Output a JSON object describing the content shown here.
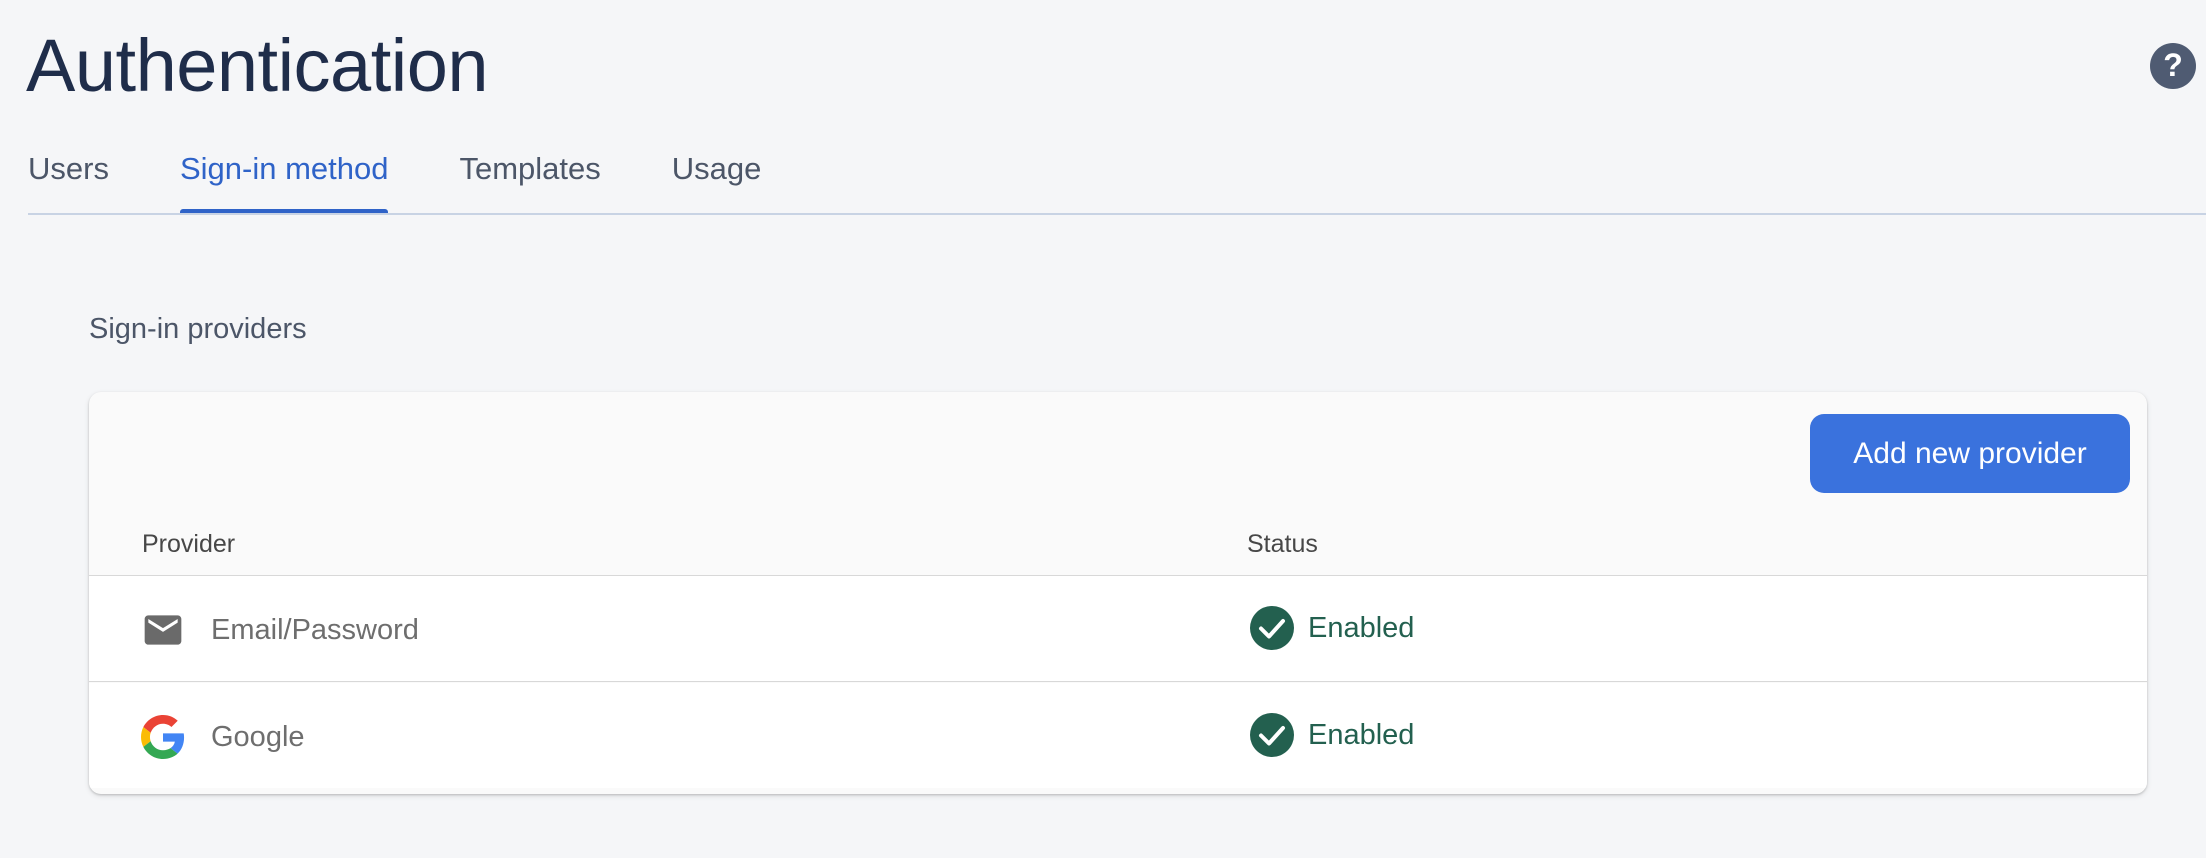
{
  "header": {
    "title": "Authentication",
    "help_icon": "help-circle-icon"
  },
  "tabs": [
    {
      "label": "Users",
      "active": false
    },
    {
      "label": "Sign-in method",
      "active": true
    },
    {
      "label": "Templates",
      "active": false
    },
    {
      "label": "Usage",
      "active": false
    }
  ],
  "section": {
    "title": "Sign-in providers"
  },
  "card": {
    "add_button_label": "Add new provider",
    "columns": {
      "provider": "Provider",
      "status": "Status"
    },
    "rows": [
      {
        "icon": "email-icon",
        "provider": "Email/Password",
        "status": "Enabled"
      },
      {
        "icon": "google-logo-icon",
        "provider": "Google",
        "status": "Enabled"
      }
    ]
  },
  "colors": {
    "accent": "#2f63c8",
    "button": "#3a72dd",
    "enabled": "#23604f",
    "title": "#1f2d4a"
  }
}
